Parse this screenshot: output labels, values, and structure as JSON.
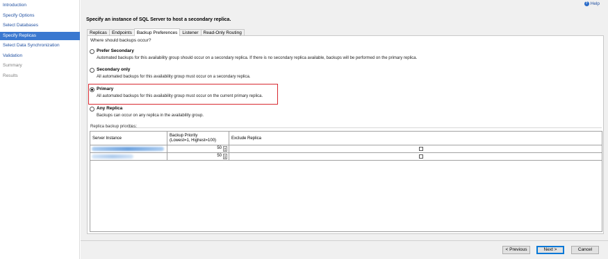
{
  "sidebar": {
    "items": [
      {
        "label": "Introduction",
        "state": "normal"
      },
      {
        "label": "Specify Options",
        "state": "normal"
      },
      {
        "label": "Select Databases",
        "state": "normal"
      },
      {
        "label": "Specify Replicas",
        "state": "active"
      },
      {
        "label": "Select Data Synchronization",
        "state": "normal"
      },
      {
        "label": "Validation",
        "state": "normal"
      },
      {
        "label": "Summary",
        "state": "disabled"
      },
      {
        "label": "Results",
        "state": "disabled"
      }
    ]
  },
  "header": {
    "help_label": "Help",
    "help_icon": "help-icon",
    "heading": "Specify an instance of SQL Server to host a secondary replica."
  },
  "tabs": [
    {
      "label": "Replicas",
      "active": false
    },
    {
      "label": "Endpoints",
      "active": false
    },
    {
      "label": "Backup Preferences",
      "active": true
    },
    {
      "label": "Listener",
      "active": false
    },
    {
      "label": "Read-Only Routing",
      "active": false
    }
  ],
  "backup": {
    "question": "Where should backups occur?",
    "options": [
      {
        "label": "Prefer Secondary",
        "description": "Automated backups for this availability group should occur on a secondary replica. If there is no secondary replica available, backups will be performed on the primary replica.",
        "checked": false
      },
      {
        "label": "Secondary only",
        "description": "All automated backups for this availability group must occur on a secondary replica.",
        "checked": false
      },
      {
        "label": "Primary",
        "description": "All automated backups for this availability group must occur on the current primary replica.",
        "checked": true
      },
      {
        "label": "Any Replica",
        "description": "Backups can occur on any replica in the availability group.",
        "checked": false
      }
    ],
    "highlight_color": "#d7282f"
  },
  "priorities": {
    "label": "Replica backup priorities:",
    "columns": {
      "server": "Server Instance",
      "priority_line1": "Backup Priority",
      "priority_line2": "(Lowest=1, Highest=100)",
      "exclude": "Exclude Replica"
    },
    "rows": [
      {
        "priority": "50",
        "exclude": false
      },
      {
        "priority": "50",
        "exclude": false
      }
    ]
  },
  "buttons": {
    "previous": "< Previous",
    "next": "Next >",
    "cancel": "Cancel"
  },
  "colors": {
    "nav_active_bg": "#3a78d0",
    "link": "#1f4fa0"
  }
}
